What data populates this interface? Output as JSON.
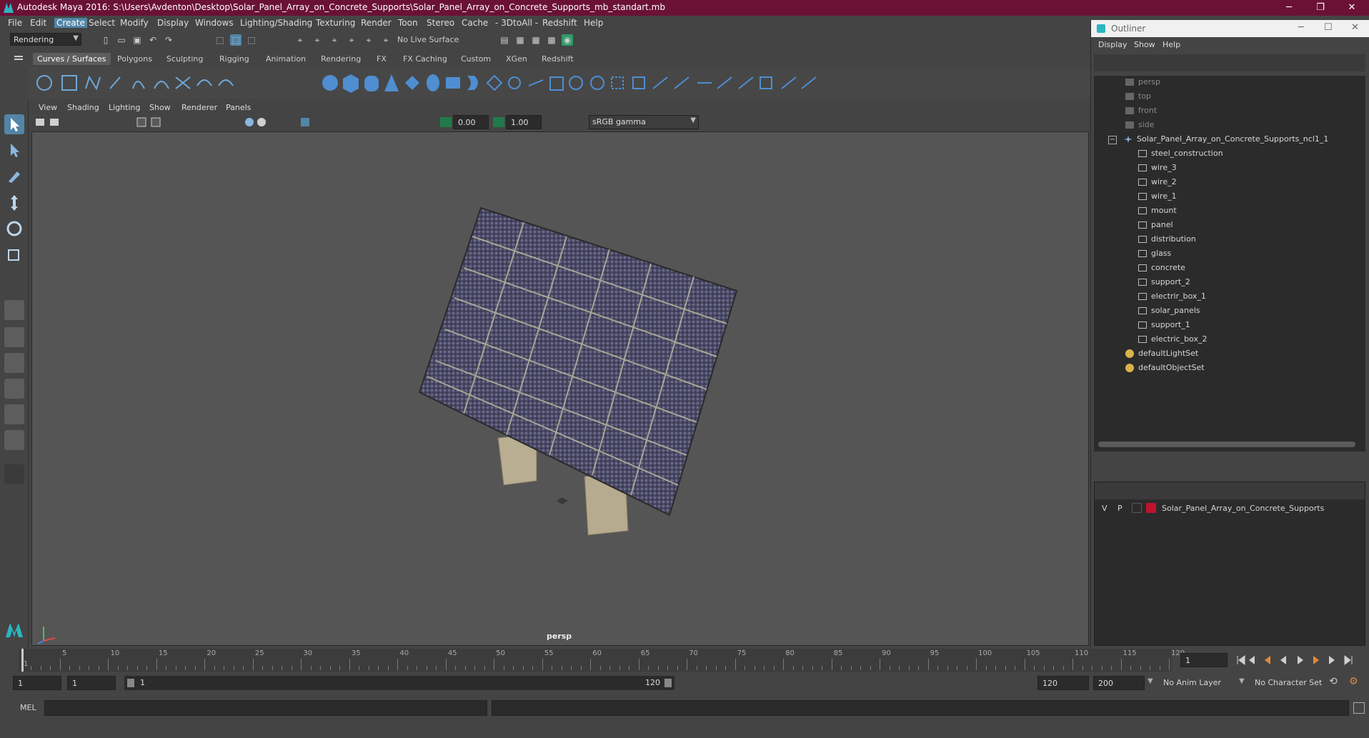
{
  "window": {
    "title": "Autodesk Maya 2016: S:\\Users\\Avdenton\\Desktop\\Solar_Panel_Array_on_Concrete_Supports\\Solar_Panel_Array_on_Concrete_Supports_mb_standart.mb",
    "minimize": "─",
    "maximize": "❐",
    "close": "✕"
  },
  "menubar": [
    "File",
    "Edit",
    "Create",
    "Select",
    "Modify",
    "Display",
    "Windows",
    "Lighting/Shading",
    "Texturing",
    "Render",
    "Toon",
    "Stereo",
    "Cache",
    "- 3DtoAll -",
    "Redshift",
    "Help"
  ],
  "statusline": {
    "mode": "Rendering",
    "live_surface": "No Live Surface"
  },
  "shelf_tabs": [
    "Curves / Surfaces",
    "Polygons",
    "Sculpting",
    "Rigging",
    "Animation",
    "Rendering",
    "FX",
    "FX Caching",
    "Custom",
    "XGen",
    "Redshift"
  ],
  "panel_menu": [
    "View",
    "Shading",
    "Lighting",
    "Show",
    "Renderer",
    "Panels"
  ],
  "view_toolbar": {
    "exposure": "0.00",
    "gamma": "1.00",
    "color_space": "sRGB gamma"
  },
  "viewport": {
    "camera": "persp"
  },
  "outliner": {
    "title": "Outliner",
    "menu": [
      "Display",
      "Show",
      "Help"
    ],
    "items": [
      {
        "label": "persp",
        "type": "camera",
        "dim": true
      },
      {
        "label": "top",
        "type": "camera",
        "dim": true
      },
      {
        "label": "front",
        "type": "camera",
        "dim": true
      },
      {
        "label": "side",
        "type": "camera",
        "dim": true
      },
      {
        "label": "Solar_Panel_Array_on_Concrete_Supports_ncl1_1",
        "type": "group",
        "dim": false
      },
      {
        "label": "steel_construction",
        "type": "mesh",
        "dim": false
      },
      {
        "label": "wire_3",
        "type": "mesh",
        "dim": false
      },
      {
        "label": "wire_2",
        "type": "mesh",
        "dim": false
      },
      {
        "label": "wire_1",
        "type": "mesh",
        "dim": false
      },
      {
        "label": "mount",
        "type": "mesh",
        "dim": false
      },
      {
        "label": "panel",
        "type": "mesh",
        "dim": false
      },
      {
        "label": "distribution",
        "type": "mesh",
        "dim": false
      },
      {
        "label": "glass",
        "type": "mesh",
        "dim": false
      },
      {
        "label": "concrete",
        "type": "mesh",
        "dim": false
      },
      {
        "label": "support_2",
        "type": "mesh",
        "dim": false
      },
      {
        "label": "electrir_box_1",
        "type": "mesh",
        "dim": false
      },
      {
        "label": "solar_panels",
        "type": "mesh",
        "dim": false
      },
      {
        "label": "support_1",
        "type": "mesh",
        "dim": false
      },
      {
        "label": "electric_box_2",
        "type": "mesh",
        "dim": false
      },
      {
        "label": "defaultLightSet",
        "type": "set",
        "dim": false
      },
      {
        "label": "defaultObjectSet",
        "type": "set",
        "dim": false
      }
    ]
  },
  "layers": {
    "v": "V",
    "p": "P",
    "name": "Solar_Panel_Array_on_Concrete_Supports",
    "color": "#c0122e"
  },
  "timeline": {
    "labels": [
      "1",
      "5",
      "10",
      "15",
      "20",
      "25",
      "30",
      "35",
      "40",
      "45",
      "50",
      "55",
      "60",
      "65",
      "70",
      "75",
      "80",
      "85",
      "90",
      "95",
      "100",
      "105",
      "110",
      "115",
      "120"
    ],
    "current_frame": "1"
  },
  "range": {
    "start": "1",
    "start2": "1",
    "slider_start": "1",
    "slider_end": "120",
    "end": "120",
    "anim_end": "200",
    "anim_layer": "No Anim Layer",
    "char_set": "No Character Set"
  },
  "cmdline": {
    "label": "MEL"
  },
  "colors": {
    "titlebar": "#6b1136",
    "accent": "#5285a6",
    "viewport_bg": "#555555",
    "panel_tint": "#45455e"
  }
}
